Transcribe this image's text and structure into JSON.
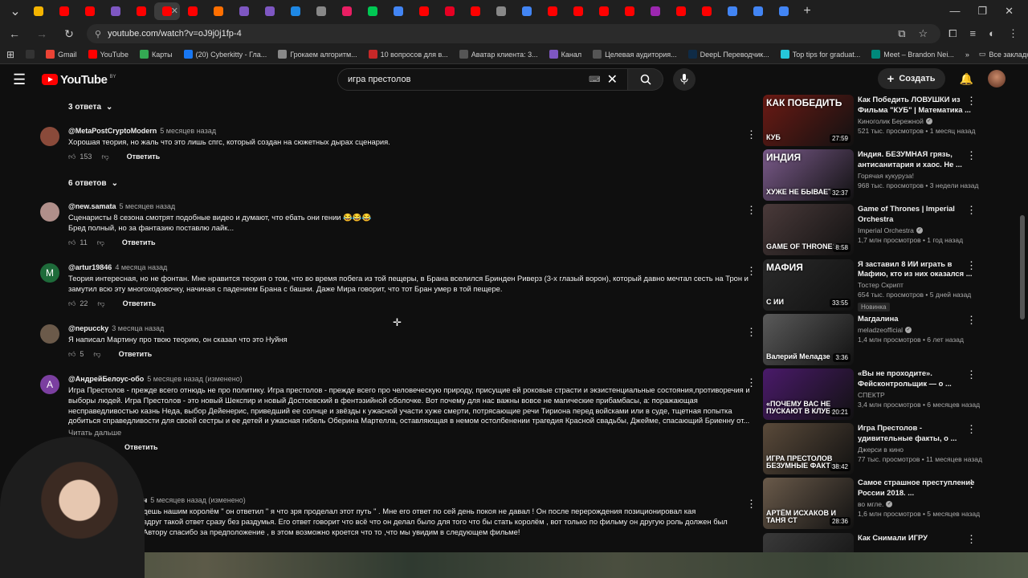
{
  "browser": {
    "tabs_count": 30,
    "url": "youtube.com/watch?v=oJ9j0j1fp-4",
    "window_controls": [
      "—",
      "❐",
      "✕"
    ],
    "bookmarks": [
      {
        "label": "Gmail",
        "color": "#ea4335"
      },
      {
        "label": "YouTube",
        "color": "#ff0000"
      },
      {
        "label": "Карты",
        "color": "#34a853"
      },
      {
        "label": "(20) Cyberkitty - Гла...",
        "color": "#1877f2"
      },
      {
        "label": "Грокаем алгоритм...",
        "color": "#888888"
      },
      {
        "label": "10 вопросов для в...",
        "color": "#c62828"
      },
      {
        "label": "Аватар клиента: 3...",
        "color": "#555555"
      },
      {
        "label": "Канал",
        "color": "#7e57c2"
      },
      {
        "label": "Целевая аудитория...",
        "color": "#555555"
      },
      {
        "label": "DeepL Переводчик...",
        "color": "#0f2b46"
      },
      {
        "label": "Top tips for graduat...",
        "color": "#26c6da"
      },
      {
        "label": "Meet – Brandon Nei...",
        "color": "#00897b"
      }
    ],
    "all_bookmarks": "Все закладки"
  },
  "yt": {
    "logo_text": "YouTube",
    "logo_region": "BY",
    "search_value": "игра престолов",
    "create_label": "Создать"
  },
  "comments": {
    "replies_top": "3 ответа",
    "replies_mid": "6 ответов",
    "reply_label": "Ответить",
    "read_more": "Читать дальше",
    "items": [
      {
        "author": "@MetaPostCryptoModern",
        "date": "5 месяцев назад",
        "text": "Хорошая теория, но жаль что это лишь спгс, который создан на сюжетных дырах сценария.",
        "likes": "153",
        "avatar_color": "#8a4a3a"
      },
      {
        "author": "@new.samata",
        "date": "5 месяцев назад",
        "text": "Сценаристы 8 сезона смотрят подобные видео и думают, что ебать они гении 😂😂😂\nБред полный, но за фантазию поставлю лайк...",
        "likes": "11",
        "avatar_color": "#b08f8a"
      },
      {
        "author": "@artur19846",
        "date": "4 месяца назад",
        "text": "Теория интересная, но не фонтан. Мне нравится теория о том, что во время побега из той пещеры, в Брана вселился Бринден Риверз (3-х глазый ворон), который давно мечтал сесть на Трон и замутил всю эту многоходовочку, начиная с падением Брана с башни. Даже Мира говорит, что тот Бран умер в той пещере.",
        "likes": "22",
        "avatar_letter": "M",
        "avatar_color": "#1e6b3a"
      },
      {
        "author": "@nepuccky",
        "date": "3 месяца назад",
        "text": "Я написал Мартину про твою теорию, он сказал что это Нуйня",
        "likes": "5",
        "avatar_color": "#6b5a4a"
      },
      {
        "author": "@АндрейБелоус-обо",
        "date": "5 месяцев назад (изменено)",
        "text": "Игра Престолов - прежде всего отнюдь не про политику. Игра престолов - прежде всего про человеческую природу, присущие ей роковые страсти и экзистенциальные состояния,противоречия и выборы людей. Игра Престолов - это новый Шекспир и новый Достоевский в фентэзийной оболочке. Вот почему для нас важны вовсе не магические прибамбасы, а: поражающая несправедливостью казнь Неда, выбор Дейенерис, приведший ее солнце и звёзды к ужасной участи хуже смерти, потрясающие речи Тириона перед войсками или в суде, тщетная попытка добиться справедливости для своей сестры и ее детей и ужасная гибель Оберина Мартелла, оставляющая в немом остолбенении  трагедия Красной свадьбы, Джейме, спасающий Бриенну от...",
        "avatar_letter": "A",
        "avatar_color": "#7b3fa0"
      },
      {
        "author": "ч",
        "date": "5 месяцев назад (изменено)",
        "text": "дешь нашим королём \" он ответил \" я что зря проделал этот путь \" . Мне его ответ по сей день покоя не давал ! Он после перерождения позиционировал кая\nвдруг такой ответ сразу без раздумья. Его ответ говорит что всё что он делал было для того что бы стать королём , вот только по фильму он другую роль должен был\nАвтору спасибо за предположение , в этом возможно кроется что то ,что мы увидим в следующем фильме!"
      }
    ]
  },
  "sidebar": {
    "videos": [
      {
        "title": "Как Победить ЛОВУШКИ из Фильма \"КУБ\" | Математика ...",
        "channel": "Киноголик Бережной",
        "verified": true,
        "stats": "521 тыс. просмотров • 1 месяц назад",
        "duration": "27:59",
        "thumb_text": "КАК ПОБЕДИТЬ",
        "thumb_text2": "КУБ",
        "thumb_color": "#6b1a14"
      },
      {
        "title": "Индия. БЕЗУМНАЯ грязь, антисанитария и хаос. Не ...",
        "channel": "Горячая кукуруза!",
        "verified": false,
        "stats": "968 тыс. просмотров • 3 недели назад",
        "duration": "32:37",
        "thumb_text": "ИНДИЯ",
        "thumb_text2": "ХУЖЕ НЕ БЫВАЕТ",
        "thumb_color": "#7a5a8a"
      },
      {
        "title": "Game of Thrones | Imperial Orchestra",
        "channel": "Imperial Orchestra",
        "verified": true,
        "stats": "1,7 млн просмотров • 1 год назад",
        "duration": "8:58",
        "thumb_text": "",
        "thumb_text2": "GAME OF THRONES",
        "thumb_color": "#4a3a3a"
      },
      {
        "title": "Я заставил 8 ИИ играть в Мафию, кто из них оказался ...",
        "channel": "Тостер Скрипт",
        "verified": false,
        "stats": "654 тыс. просмотров • 5 дней назад",
        "badge": "Новинка",
        "duration": "33:55",
        "thumb_text": "МАФИЯ",
        "thumb_text2": "С ИИ",
        "thumb_color": "#2a2a2a"
      },
      {
        "title": "Магдалина",
        "channel": "meladzeofficial",
        "verified": true,
        "stats": "1,4 млн просмотров • 6 лет назад",
        "duration": "3:36",
        "thumb_text": "",
        "thumb_text2": "Валерий Меладзе",
        "thumb_color": "#5a5a5a"
      },
      {
        "title": "«Вы не проходите». Фейсконтрольщик — о ...",
        "channel": "СПЕКТР",
        "verified": false,
        "stats": "3,4 млн просмотров • 6 месяцев назад",
        "duration": "20:21",
        "thumb_text": "",
        "thumb_text2": "«ПОЧЕМУ ВАС НЕ ПУСКАЮТ В КЛУБ»",
        "thumb_color": "#4a1a6a"
      },
      {
        "title": "Игра Престолов - удивительные факты, о ...",
        "channel": "Джерси в кино",
        "verified": false,
        "stats": "77 тыс. просмотров • 11 месяцев назад",
        "duration": "38:42",
        "thumb_text": "",
        "thumb_text2": "ИГРА ПРЕСТОЛОВ БЕЗУМНЫЕ ФАКТЫ",
        "thumb_color": "#5a4a3a"
      },
      {
        "title": "Самое страшное преступление России 2018. ...",
        "channel": "во мгле.",
        "verified": true,
        "stats": "1,6 млн просмотров • 5 месяцев назад",
        "duration": "28:36",
        "thumb_text": "",
        "thumb_text2": "АРТЁМ ИСХАКОВ И ТАНЯ СТ",
        "thumb_color": "#6a5a4a"
      },
      {
        "title": "Как Снимали ИГРУ",
        "channel": "",
        "verified": false,
        "stats": "",
        "duration": "",
        "thumb_text": "",
        "thumb_text2": "",
        "thumb_color": "#3a3a3a"
      }
    ]
  }
}
